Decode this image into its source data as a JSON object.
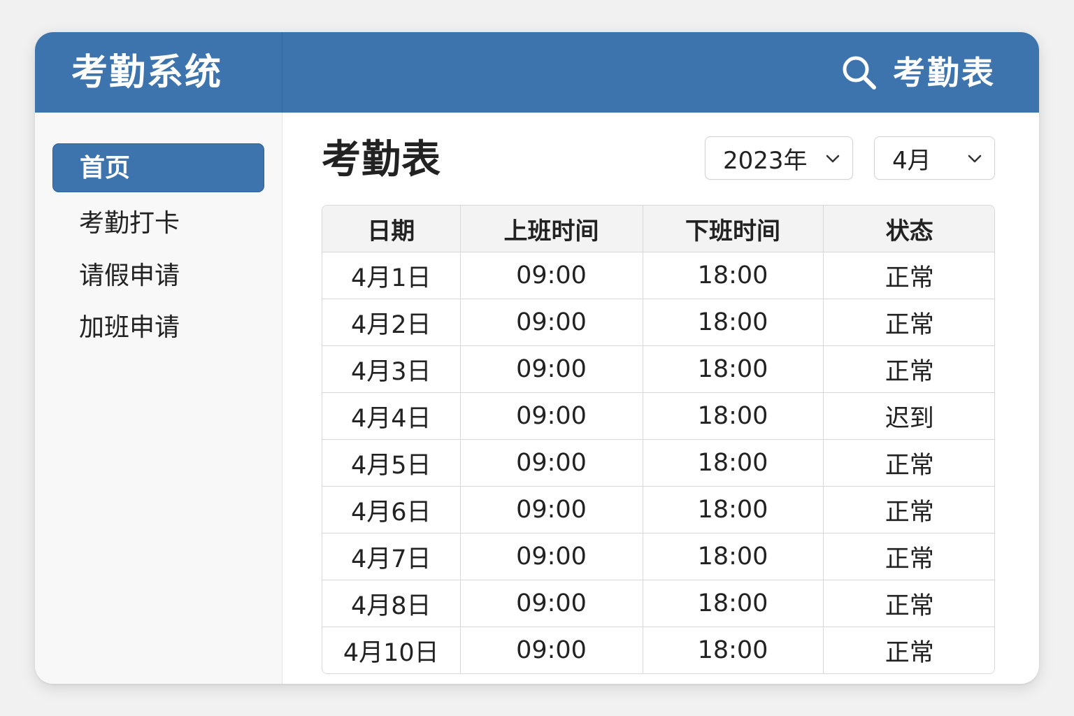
{
  "app": {
    "title": "考勤系统",
    "header_link": "考勤表",
    "search_icon": "search-icon"
  },
  "colors": {
    "brand": "#3d74ad",
    "background": "#f1f1f1",
    "sidebar": "#f8f8f8"
  },
  "sidebar": {
    "items": [
      {
        "label": "首页",
        "active": true
      },
      {
        "label": "考勤打卡",
        "active": false
      },
      {
        "label": "请假申请",
        "active": false
      },
      {
        "label": "加班申请",
        "active": false
      }
    ]
  },
  "main": {
    "title": "考勤表",
    "year_select": {
      "value": "2023年"
    },
    "month_select": {
      "value": "4月"
    },
    "table": {
      "columns": [
        "日期",
        "上班时间",
        "下班时间",
        "状态"
      ],
      "rows": [
        [
          "4月1日",
          "09:00",
          "18:00",
          "正常"
        ],
        [
          "4月2日",
          "09:00",
          "18:00",
          "正常"
        ],
        [
          "4月3日",
          "09:00",
          "18:00",
          "正常"
        ],
        [
          "4月4日",
          "09:00",
          "18:00",
          "迟到"
        ],
        [
          "4月5日",
          "09:00",
          "18:00",
          "正常"
        ],
        [
          "4月6日",
          "09:00",
          "18:00",
          "正常"
        ],
        [
          "4月7日",
          "09:00",
          "18:00",
          "正常"
        ],
        [
          "4月8日",
          "09:00",
          "18:00",
          "正常"
        ],
        [
          "4月10日",
          "09:00",
          "18:00",
          "正常"
        ]
      ]
    }
  }
}
